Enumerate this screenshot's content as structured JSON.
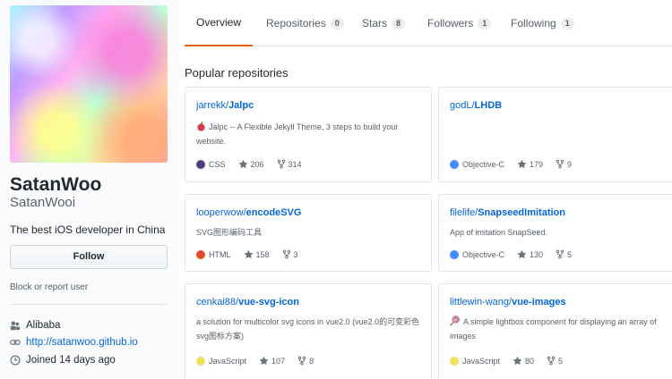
{
  "profile": {
    "name": "SatanWoo",
    "username": "SatanWooi",
    "bio": "The best iOS developer in China",
    "follow_label": "Follow",
    "block_label": "Block or report user",
    "company": "Alibaba",
    "website": "http://satanwoo.github.io",
    "joined": "Joined 14 days ago"
  },
  "tabs": [
    {
      "label": "Overview",
      "count": null,
      "active": true
    },
    {
      "label": "Repositories",
      "count": "0"
    },
    {
      "label": "Stars",
      "count": "8"
    },
    {
      "label": "Followers",
      "count": "1"
    },
    {
      "label": "Following",
      "count": "1"
    }
  ],
  "section_title": "Popular repositories",
  "repos": [
    {
      "owner": "jarrekk/",
      "name": "Jalpc",
      "description": "Jalpc -- A Flexible Jekyll Theme, 3 steps to build your website.",
      "icon": "apple-icon",
      "language": "CSS",
      "language_color": "#563d7c",
      "stars": "206",
      "forks": "314"
    },
    {
      "owner": "godL/",
      "name": "LHDB",
      "description": "",
      "language": "Objective-C",
      "language_color": "#438eff",
      "stars": "179",
      "forks": "9"
    },
    {
      "owner": "looperwow/",
      "name": "encodeSVG",
      "description": "SVG图形编码工具",
      "language": "HTML",
      "language_color": "#e34c26",
      "stars": "158",
      "forks": "3"
    },
    {
      "owner": "filelife/",
      "name": "SnapseedImitation",
      "description": "App of imitation SnapSeed.",
      "language": "Objective-C",
      "language_color": "#438eff",
      "stars": "130",
      "forks": "5"
    },
    {
      "owner": "cenkai88/",
      "name": "vue-svg-icon",
      "description": "a solution for multicolor svg icons in vue2.0 (vue2.0的可变彩色svg图标方案)",
      "language": "JavaScript",
      "language_color": "#f1e05a",
      "stars": "107",
      "forks": "8"
    },
    {
      "owner": "littlewin-wang/",
      "name": "vue-images",
      "description": "A simple lightbox component for displaying an array of images",
      "icon": "lollipop-icon",
      "language": "JavaScript",
      "language_color": "#f1e05a",
      "stars": "80",
      "forks": "5"
    }
  ]
}
